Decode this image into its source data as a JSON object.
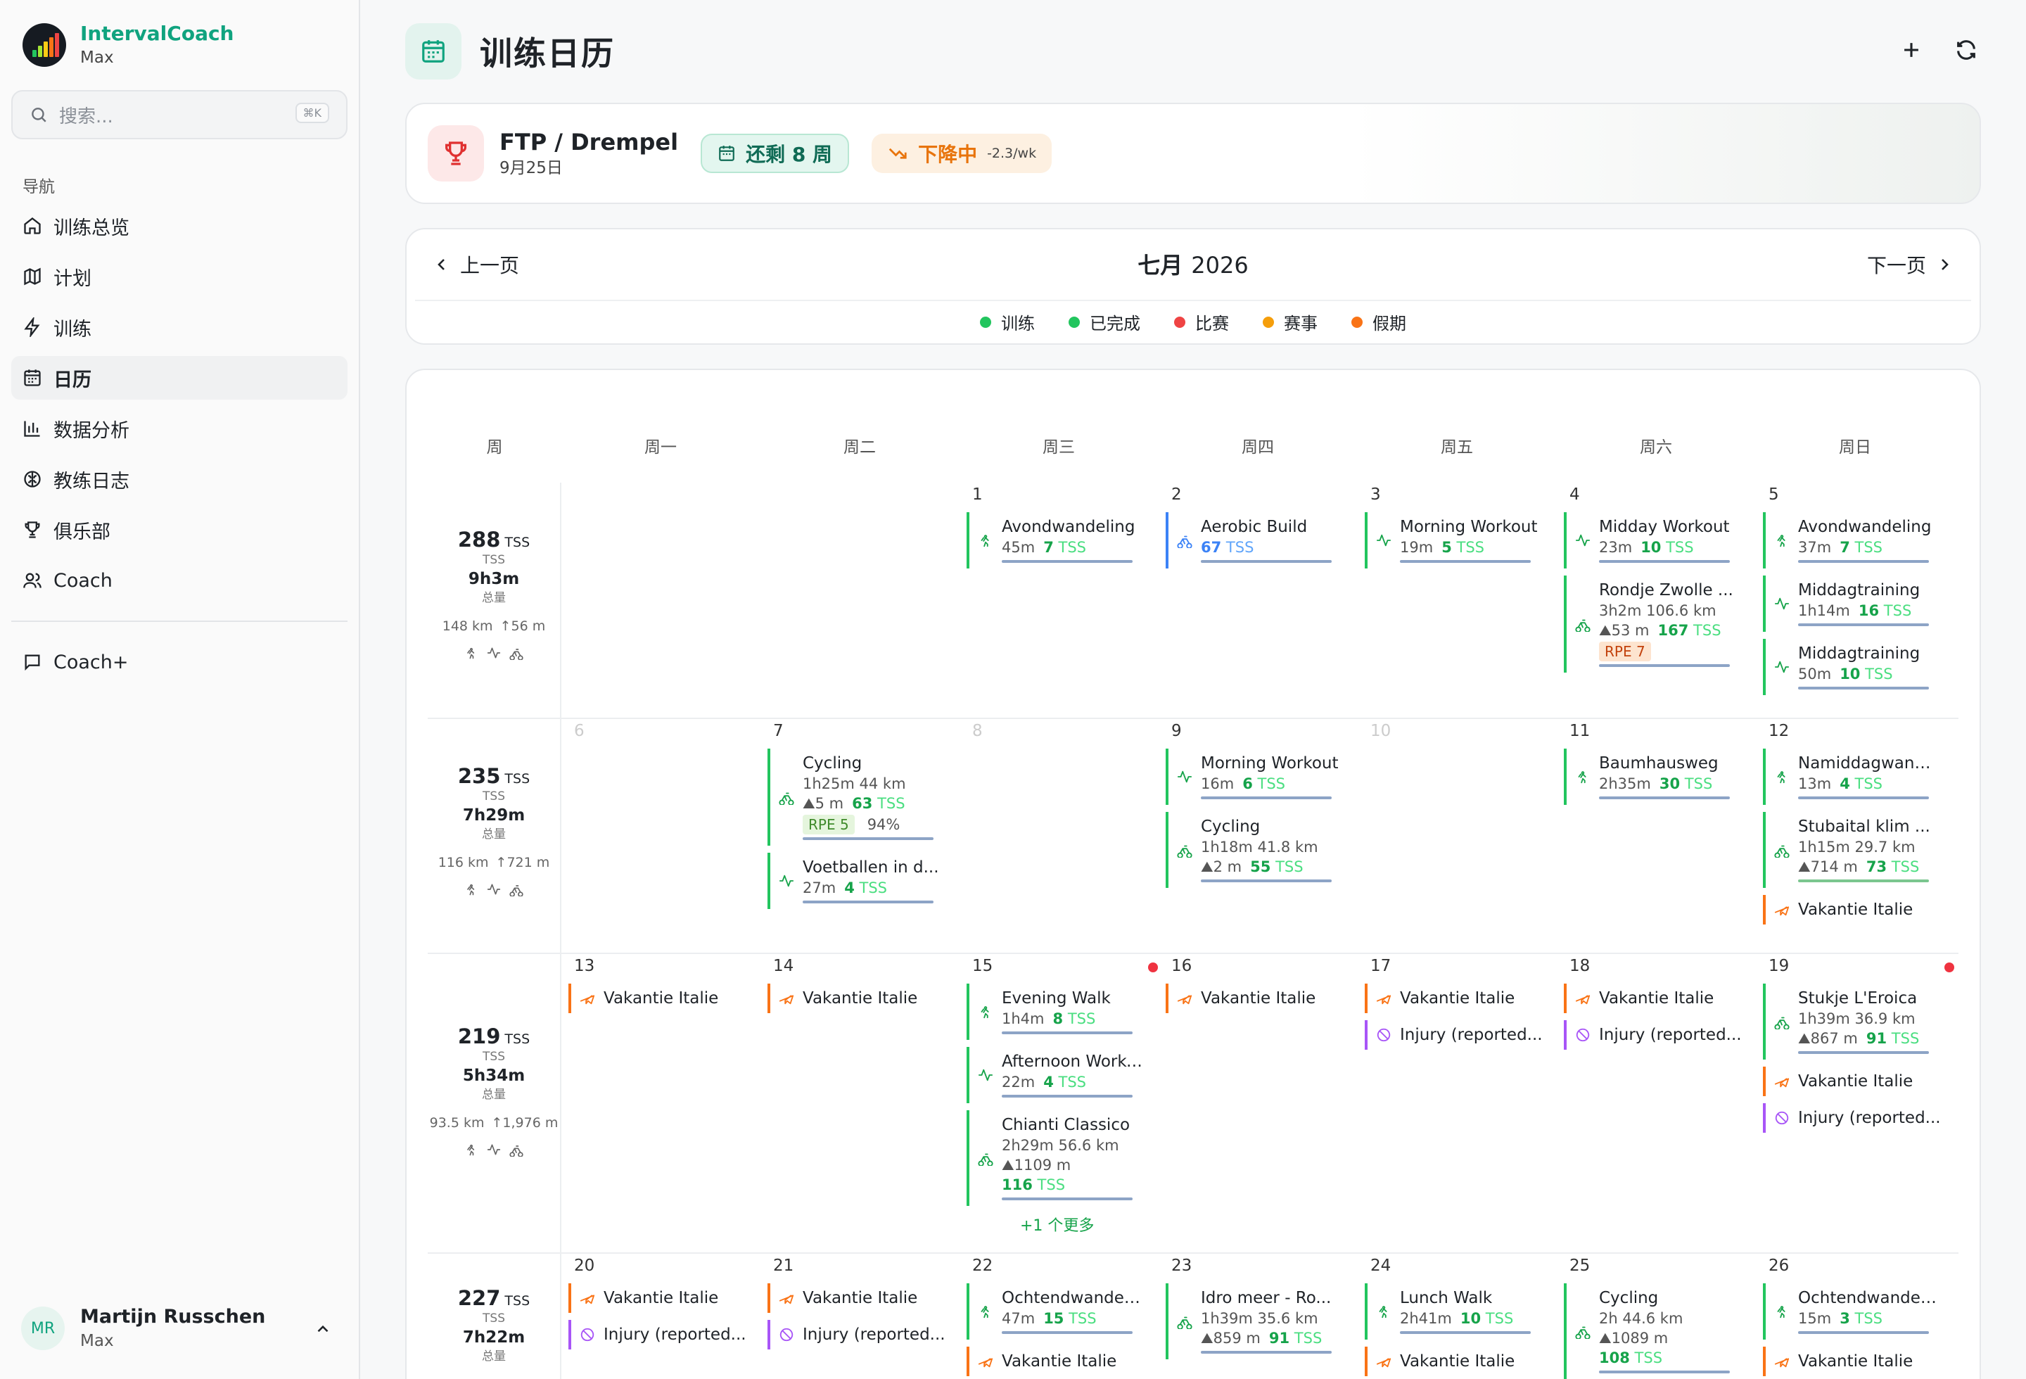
{
  "brand": {
    "name": "IntervalCoach",
    "user": "Max"
  },
  "search": {
    "placeholder": "搜索...",
    "shortcut": "⌘K"
  },
  "nav": {
    "label": "导航",
    "items": [
      {
        "label": "训练总览",
        "icon": "home-icon"
      },
      {
        "label": "计划",
        "icon": "map-icon"
      },
      {
        "label": "训练",
        "icon": "bolt-icon"
      },
      {
        "label": "日历",
        "icon": "calendar-icon",
        "active": true
      },
      {
        "label": "数据分析",
        "icon": "bar-chart-icon"
      },
      {
        "label": "教练日志",
        "icon": "brain-icon"
      },
      {
        "label": "俱乐部",
        "icon": "trophy-icon"
      },
      {
        "label": "Coach",
        "icon": "users-icon"
      }
    ],
    "extra": {
      "label": "Coach+",
      "icon": "message-icon"
    }
  },
  "profile": {
    "initials": "MR",
    "name": "Martijn Russchen",
    "sub": "Max"
  },
  "page": {
    "title": "训练日历"
  },
  "ftp": {
    "title": "FTP / Drempel",
    "date": "9月25日",
    "weeks_left": "还剩 8 周",
    "trend": "下降中",
    "trend_rate": "-2.3/wk"
  },
  "calendar": {
    "prev": "上一页",
    "next": "下一页",
    "month": "七月",
    "year": "2026",
    "legend": [
      {
        "label": "训练",
        "color": "#22c55e"
      },
      {
        "label": "已完成",
        "color": "#22c55e"
      },
      {
        "label": "比赛",
        "color": "#ef4444"
      },
      {
        "label": "赛事",
        "color": "#f59e0b"
      },
      {
        "label": "假期",
        "color": "#f97316"
      }
    ],
    "headers": [
      "周",
      "周一",
      "周二",
      "周三",
      "周四",
      "周五",
      "周六",
      "周日"
    ],
    "weeks": [
      {
        "tss": "288",
        "tss_unit": "TSS",
        "tss_label": "TSS",
        "time": "9h3m",
        "time_label": "总量",
        "dist": "148 km",
        "elev": "↑56 m",
        "days": [
          {
            "num": "",
            "events": []
          },
          {
            "num": "",
            "events": []
          },
          {
            "num": "1",
            "events": [
              {
                "kind": "walk",
                "title": "Avondwandeling",
                "meta": "45m",
                "tss": "7"
              }
            ]
          },
          {
            "num": "2",
            "events": [
              {
                "kind": "bike",
                "color": "blue",
                "title": "Aerobic Build",
                "meta": "",
                "tss": "67"
              }
            ]
          },
          {
            "num": "3",
            "events": [
              {
                "kind": "activity",
                "title": "Morning Workout",
                "meta": "19m",
                "tss": "5"
              }
            ]
          },
          {
            "num": "4",
            "events": [
              {
                "kind": "activity",
                "title": "Midday Workout",
                "meta": "23m",
                "tss": "10"
              },
              {
                "kind": "bike",
                "title": "Rondje Zwolle ...",
                "meta": "3h2m  106.6 km",
                "meta2": "⛰53 m",
                "tss": "167",
                "rpe": "RPE 7"
              }
            ]
          },
          {
            "num": "5",
            "events": [
              {
                "kind": "walk",
                "title": "Avondwandeling",
                "meta": "37m",
                "tss": "7"
              },
              {
                "kind": "activity",
                "title": "Middagtraining",
                "meta": "1h14m",
                "tss": "16"
              },
              {
                "kind": "activity",
                "title": "Middagtraining",
                "meta": "50m",
                "tss": "10"
              }
            ]
          }
        ]
      },
      {
        "tss": "235",
        "tss_unit": "TSS",
        "tss_label": "TSS",
        "time": "7h29m",
        "time_label": "总量",
        "dist": "116 km",
        "elev": "↑721 m",
        "days": [
          {
            "num": "6",
            "muted": true,
            "events": []
          },
          {
            "num": "7",
            "events": [
              {
                "kind": "bike",
                "title": "Cycling",
                "meta": "1h25m  44 km",
                "meta2": "⛰5 m",
                "tss": "63",
                "rpe": "RPE 5",
                "rpe_green": true,
                "extra": "94%"
              },
              {
                "kind": "activity",
                "title": "Voetballen in d...",
                "meta": "27m",
                "tss": "4"
              }
            ]
          },
          {
            "num": "8",
            "muted": true,
            "events": []
          },
          {
            "num": "9",
            "events": [
              {
                "kind": "activity",
                "title": "Morning Workout",
                "meta": "16m",
                "tss": "6"
              },
              {
                "kind": "bike",
                "title": "Cycling",
                "meta": "1h18m  41.8 km",
                "meta2": "⛰2 m",
                "tss": "55"
              }
            ]
          },
          {
            "num": "10",
            "muted": true,
            "events": []
          },
          {
            "num": "11",
            "events": [
              {
                "kind": "walk",
                "title": "Baumhausweg",
                "meta": "2h35m",
                "tss": "30"
              }
            ]
          },
          {
            "num": "12",
            "events": [
              {
                "kind": "walk",
                "title": "Namiddagwandeling",
                "meta": "13m",
                "tss": "4"
              },
              {
                "kind": "bike",
                "title": "Stubaital klim ...",
                "meta": "1h15m  29.7 km",
                "meta2": "⛰714 m",
                "tss": "73",
                "bar_green": true
              },
              {
                "kind": "vacation",
                "title": "Vakantie Italie"
              }
            ]
          }
        ]
      },
      {
        "tss": "219",
        "tss_unit": "TSS",
        "tss_label": "TSS",
        "time": "5h34m",
        "time_label": "总量",
        "dist": "93.5 km",
        "elev": "↑1,976 m",
        "days": [
          {
            "num": "13",
            "events": [
              {
                "kind": "vacation",
                "title": "Vakantie Italie"
              }
            ]
          },
          {
            "num": "14",
            "events": [
              {
                "kind": "vacation",
                "title": "Vakantie Italie"
              }
            ]
          },
          {
            "num": "15",
            "dot": true,
            "events": [
              {
                "kind": "walk",
                "title": "Evening Walk",
                "meta": "1h4m",
                "tss": "8"
              },
              {
                "kind": "activity",
                "title": "Afternoon Workout",
                "meta": "22m",
                "tss": "4"
              },
              {
                "kind": "bike",
                "title": "Chianti Classico",
                "meta": "2h29m  56.6 km",
                "meta2": "⛰1109 m",
                "tss": "116",
                "tss_newline": true
              }
            ],
            "more": "+1 个更多"
          },
          {
            "num": "16",
            "events": [
              {
                "kind": "vacation",
                "title": "Vakantie Italie"
              }
            ]
          },
          {
            "num": "17",
            "events": [
              {
                "kind": "vacation",
                "title": "Vakantie Italie"
              },
              {
                "kind": "injury",
                "title": "Injury (reported..."
              }
            ]
          },
          {
            "num": "18",
            "events": [
              {
                "kind": "vacation",
                "title": "Vakantie Italie"
              },
              {
                "kind": "injury",
                "title": "Injury (reported..."
              }
            ]
          },
          {
            "num": "19",
            "dot": true,
            "events": [
              {
                "kind": "bike",
                "title": "Stukje L'Eroica",
                "meta": "1h39m  36.9 km",
                "meta2": "⛰867 m",
                "tss": "91"
              },
              {
                "kind": "vacation",
                "title": "Vakantie Italie"
              },
              {
                "kind": "injury",
                "title": "Injury (reported..."
              }
            ]
          }
        ]
      },
      {
        "tss": "227",
        "tss_unit": "TSS",
        "tss_label": "TSS",
        "time": "7h22m",
        "time_label": "总量",
        "dist": "",
        "elev": "",
        "days": [
          {
            "num": "20",
            "events": [
              {
                "kind": "vacation",
                "title": "Vakantie Italie"
              },
              {
                "kind": "injury",
                "title": "Injury (reported..."
              }
            ]
          },
          {
            "num": "21",
            "events": [
              {
                "kind": "vacation",
                "title": "Vakantie Italie"
              },
              {
                "kind": "injury",
                "title": "Injury (reported..."
              }
            ]
          },
          {
            "num": "22",
            "events": [
              {
                "kind": "walk",
                "title": "Ochtendwandeling",
                "meta": "47m",
                "tss": "15"
              },
              {
                "kind": "vacation",
                "title": "Vakantie Italie"
              }
            ]
          },
          {
            "num": "23",
            "events": [
              {
                "kind": "bike",
                "title": "Idro meer - Ro...",
                "meta": "1h39m  35.6 km",
                "meta2": "⛰859 m",
                "tss": "91"
              }
            ]
          },
          {
            "num": "24",
            "events": [
              {
                "kind": "walk",
                "title": "Lunch Walk",
                "meta": "2h41m",
                "tss": "10"
              },
              {
                "kind": "vacation",
                "title": "Vakantie Italie"
              }
            ]
          },
          {
            "num": "25",
            "events": [
              {
                "kind": "bike",
                "title": "Cycling",
                "meta": "2h  44.6 km",
                "meta2": "⛰1089 m",
                "tss": "108",
                "tss_newline": true
              }
            ]
          },
          {
            "num": "26",
            "events": [
              {
                "kind": "walk",
                "title": "Ochtendwandeling",
                "meta": "15m",
                "tss": "3"
              },
              {
                "kind": "vacation",
                "title": "Vakantie Italie"
              }
            ]
          }
        ]
      }
    ]
  }
}
